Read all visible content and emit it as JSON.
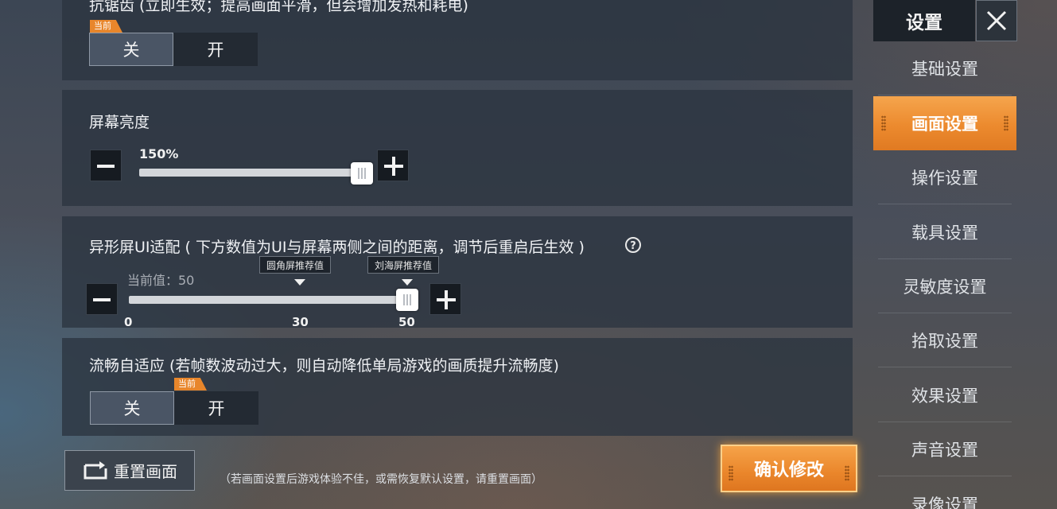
{
  "sections": {
    "antialias": {
      "title": "抗锯齿 (立即生效；提高画面平滑，但会增加发热和耗电)",
      "off": "关",
      "on": "开",
      "current_tag": "当前",
      "current": "off"
    },
    "brightness": {
      "title": "屏幕亮度",
      "value_label": "150%",
      "level": 1.0
    },
    "notch": {
      "title": "异形屏UI适配 ( 下方数值为UI与屏幕两侧之间的距离，调节后重启后生效 )",
      "current_label": "当前值：50",
      "min": 0,
      "max": 50,
      "value": 50,
      "ticks": [
        "0",
        "30",
        "50"
      ],
      "marker_round": "圆角屏推荐值",
      "marker_notch": "刘海屏推荐值"
    },
    "smooth": {
      "title": "流畅自适应 (若帧数波动过大，则自动降低单局游戏的画质提升流畅度)",
      "off": "关",
      "on": "开",
      "current_tag": "当前",
      "current": "on"
    }
  },
  "footer": {
    "reset_label": "重置画面",
    "hint": "（若画面设置后游戏体验不佳，或需恢复默认设置，请重置画面）",
    "confirm_label": "确认修改"
  },
  "sidebar": {
    "title": "设置",
    "items": [
      {
        "label": "基础设置"
      },
      {
        "label": "画面设置"
      },
      {
        "label": "操作设置"
      },
      {
        "label": "载具设置"
      },
      {
        "label": "灵敏度设置"
      },
      {
        "label": "拾取设置"
      },
      {
        "label": "效果设置"
      },
      {
        "label": "声音设置"
      },
      {
        "label": "录像设置"
      }
    ],
    "active_index": 1
  },
  "colors": {
    "accent": "#ec8a2e",
    "panel": "#2c3440"
  }
}
